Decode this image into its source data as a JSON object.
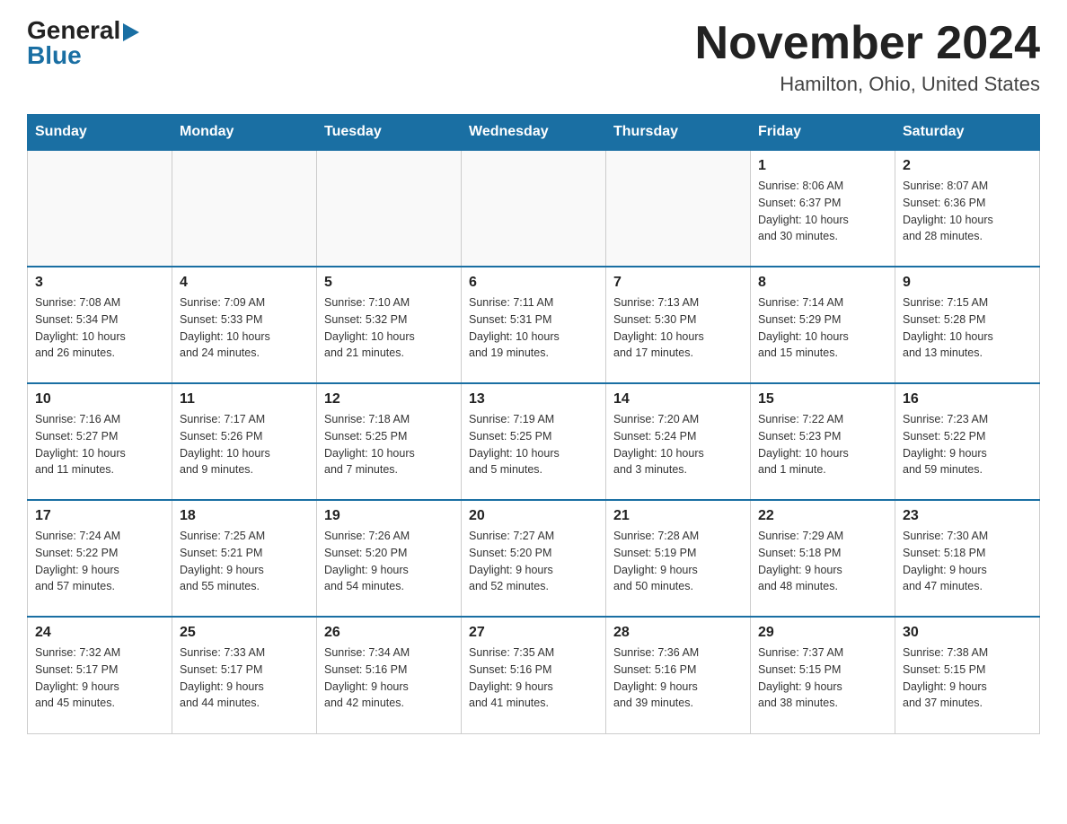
{
  "logo": {
    "general": "General",
    "blue": "Blue"
  },
  "title": "November 2024",
  "location": "Hamilton, Ohio, United States",
  "days_of_week": [
    "Sunday",
    "Monday",
    "Tuesday",
    "Wednesday",
    "Thursday",
    "Friday",
    "Saturday"
  ],
  "weeks": [
    [
      {
        "day": "",
        "info": ""
      },
      {
        "day": "",
        "info": ""
      },
      {
        "day": "",
        "info": ""
      },
      {
        "day": "",
        "info": ""
      },
      {
        "day": "",
        "info": ""
      },
      {
        "day": "1",
        "info": "Sunrise: 8:06 AM\nSunset: 6:37 PM\nDaylight: 10 hours\nand 30 minutes."
      },
      {
        "day": "2",
        "info": "Sunrise: 8:07 AM\nSunset: 6:36 PM\nDaylight: 10 hours\nand 28 minutes."
      }
    ],
    [
      {
        "day": "3",
        "info": "Sunrise: 7:08 AM\nSunset: 5:34 PM\nDaylight: 10 hours\nand 26 minutes."
      },
      {
        "day": "4",
        "info": "Sunrise: 7:09 AM\nSunset: 5:33 PM\nDaylight: 10 hours\nand 24 minutes."
      },
      {
        "day": "5",
        "info": "Sunrise: 7:10 AM\nSunset: 5:32 PM\nDaylight: 10 hours\nand 21 minutes."
      },
      {
        "day": "6",
        "info": "Sunrise: 7:11 AM\nSunset: 5:31 PM\nDaylight: 10 hours\nand 19 minutes."
      },
      {
        "day": "7",
        "info": "Sunrise: 7:13 AM\nSunset: 5:30 PM\nDaylight: 10 hours\nand 17 minutes."
      },
      {
        "day": "8",
        "info": "Sunrise: 7:14 AM\nSunset: 5:29 PM\nDaylight: 10 hours\nand 15 minutes."
      },
      {
        "day": "9",
        "info": "Sunrise: 7:15 AM\nSunset: 5:28 PM\nDaylight: 10 hours\nand 13 minutes."
      }
    ],
    [
      {
        "day": "10",
        "info": "Sunrise: 7:16 AM\nSunset: 5:27 PM\nDaylight: 10 hours\nand 11 minutes."
      },
      {
        "day": "11",
        "info": "Sunrise: 7:17 AM\nSunset: 5:26 PM\nDaylight: 10 hours\nand 9 minutes."
      },
      {
        "day": "12",
        "info": "Sunrise: 7:18 AM\nSunset: 5:25 PM\nDaylight: 10 hours\nand 7 minutes."
      },
      {
        "day": "13",
        "info": "Sunrise: 7:19 AM\nSunset: 5:25 PM\nDaylight: 10 hours\nand 5 minutes."
      },
      {
        "day": "14",
        "info": "Sunrise: 7:20 AM\nSunset: 5:24 PM\nDaylight: 10 hours\nand 3 minutes."
      },
      {
        "day": "15",
        "info": "Sunrise: 7:22 AM\nSunset: 5:23 PM\nDaylight: 10 hours\nand 1 minute."
      },
      {
        "day": "16",
        "info": "Sunrise: 7:23 AM\nSunset: 5:22 PM\nDaylight: 9 hours\nand 59 minutes."
      }
    ],
    [
      {
        "day": "17",
        "info": "Sunrise: 7:24 AM\nSunset: 5:22 PM\nDaylight: 9 hours\nand 57 minutes."
      },
      {
        "day": "18",
        "info": "Sunrise: 7:25 AM\nSunset: 5:21 PM\nDaylight: 9 hours\nand 55 minutes."
      },
      {
        "day": "19",
        "info": "Sunrise: 7:26 AM\nSunset: 5:20 PM\nDaylight: 9 hours\nand 54 minutes."
      },
      {
        "day": "20",
        "info": "Sunrise: 7:27 AM\nSunset: 5:20 PM\nDaylight: 9 hours\nand 52 minutes."
      },
      {
        "day": "21",
        "info": "Sunrise: 7:28 AM\nSunset: 5:19 PM\nDaylight: 9 hours\nand 50 minutes."
      },
      {
        "day": "22",
        "info": "Sunrise: 7:29 AM\nSunset: 5:18 PM\nDaylight: 9 hours\nand 48 minutes."
      },
      {
        "day": "23",
        "info": "Sunrise: 7:30 AM\nSunset: 5:18 PM\nDaylight: 9 hours\nand 47 minutes."
      }
    ],
    [
      {
        "day": "24",
        "info": "Sunrise: 7:32 AM\nSunset: 5:17 PM\nDaylight: 9 hours\nand 45 minutes."
      },
      {
        "day": "25",
        "info": "Sunrise: 7:33 AM\nSunset: 5:17 PM\nDaylight: 9 hours\nand 44 minutes."
      },
      {
        "day": "26",
        "info": "Sunrise: 7:34 AM\nSunset: 5:16 PM\nDaylight: 9 hours\nand 42 minutes."
      },
      {
        "day": "27",
        "info": "Sunrise: 7:35 AM\nSunset: 5:16 PM\nDaylight: 9 hours\nand 41 minutes."
      },
      {
        "day": "28",
        "info": "Sunrise: 7:36 AM\nSunset: 5:16 PM\nDaylight: 9 hours\nand 39 minutes."
      },
      {
        "day": "29",
        "info": "Sunrise: 7:37 AM\nSunset: 5:15 PM\nDaylight: 9 hours\nand 38 minutes."
      },
      {
        "day": "30",
        "info": "Sunrise: 7:38 AM\nSunset: 5:15 PM\nDaylight: 9 hours\nand 37 minutes."
      }
    ]
  ]
}
